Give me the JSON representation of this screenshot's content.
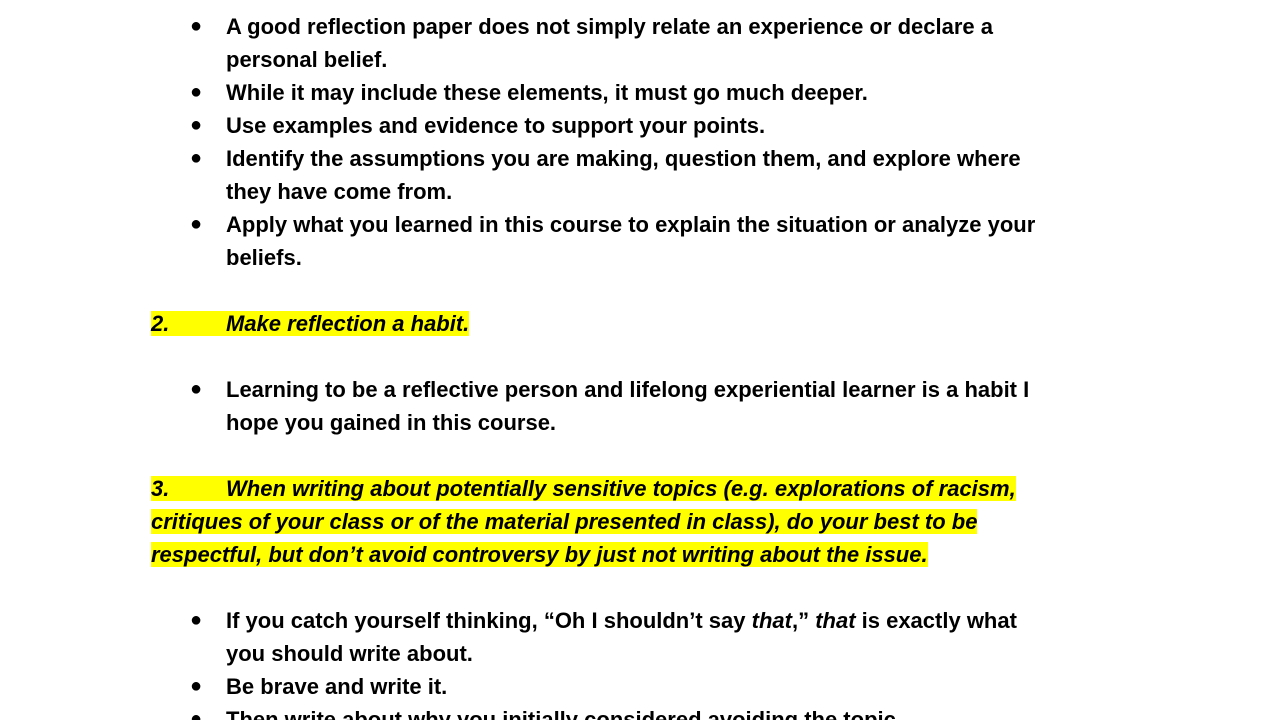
{
  "section1": {
    "bullets": [
      {
        "line1": "A good reflection paper does not simply relate an experience or declare a",
        "line2": "personal belief."
      },
      {
        "line1": "While it may include these elements, it must go much deeper."
      },
      {
        "line1": "Use examples and evidence to support your points."
      },
      {
        "line1": "Identify the assumptions you are making, question them, and explore where",
        "line2": "they have come from."
      },
      {
        "line1": "Apply what you learned in this course to explain the situation or analyze your",
        "line2": "beliefs."
      }
    ]
  },
  "section2": {
    "number": "2.",
    "heading": "Make reflection a habit.",
    "bullets": [
      {
        "line1": "Learning to be a reflective person and lifelong experiential learner is a habit I",
        "line2": "hope you gained in this course."
      }
    ]
  },
  "section3": {
    "number": "3.",
    "heading_line1": "When writing about potentially sensitive topics (e.g. explorations of racism,",
    "heading_line2": "critiques of your class or of the material presented in class), do your best to be",
    "heading_line3": "respectful, but don’t avoid controversy by just not writing about the issue.",
    "bullet1_part1": "If you catch yourself thinking, “Oh I shouldn’t say ",
    "bullet1_italic1": "that",
    "bullet1_part2": ",” ",
    "bullet1_italic2": "that",
    "bullet1_part3": " is exactly what",
    "bullet1_line2": "you should write about.",
    "bullet2": "Be brave and write it.",
    "bullet3": "Then write about why you initially considered avoiding the topic."
  },
  "bullet_glyph": "●"
}
